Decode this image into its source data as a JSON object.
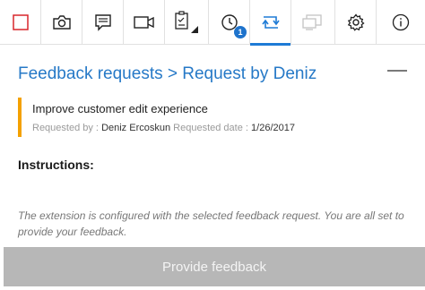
{
  "toolbar": {
    "items": [
      {
        "icon": "stop-record-icon",
        "color": "#d9262c"
      },
      {
        "icon": "camera-icon"
      },
      {
        "icon": "note-icon"
      },
      {
        "icon": "video-icon"
      },
      {
        "icon": "task-checklist-icon"
      },
      {
        "icon": "history-clock-icon",
        "badge": "1"
      },
      {
        "icon": "feedback-loop-icon",
        "active": true
      },
      {
        "icon": "screen-share-icon",
        "disabled": true
      },
      {
        "icon": "settings-gear-icon"
      },
      {
        "icon": "info-icon"
      }
    ],
    "accent": "#1e7bd6"
  },
  "header": {
    "title": "Feedback requests > Request by Deniz"
  },
  "request": {
    "title": "Improve customer edit experience",
    "requested_by_label": "Requested by :",
    "requested_by": "Deniz Ercoskun",
    "requested_date_label": "Requested date :",
    "requested_date": "1/26/2017",
    "accent": "#f4a100"
  },
  "instructions": {
    "heading": "Instructions:"
  },
  "note": "The extension is configured with the selected feedback request. You are all set to provide your feedback.",
  "cta": {
    "label": "Provide feedback"
  }
}
